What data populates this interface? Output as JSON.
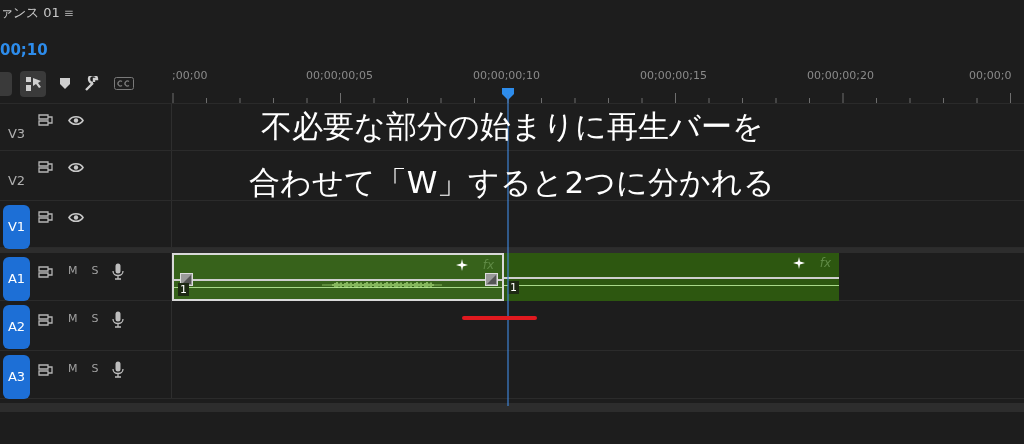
{
  "sequence_tab": {
    "title": "ァンス 01",
    "menu": "≡"
  },
  "timecode": "00;10",
  "ruler_labels": [
    ";00;00",
    "00;00;00;05",
    "00;00;00;10",
    "00;00;00;15",
    "00;00;00;20",
    "00;00;0"
  ],
  "tracks": [
    {
      "label": "V3",
      "kind": "video",
      "targeted": false
    },
    {
      "label": "V2",
      "kind": "video",
      "targeted": false
    },
    {
      "label": "V1",
      "kind": "video",
      "targeted": true
    },
    {
      "label": "A1",
      "kind": "audio",
      "targeted": true,
      "mute": "M",
      "solo": "S",
      "clips": [
        {
          "channel": "1",
          "fx": "fx",
          "selected": true,
          "kind": "waveform"
        },
        {
          "channel": "1",
          "fx": "fx",
          "selected": false,
          "kind": "silent"
        }
      ]
    },
    {
      "label": "A2",
      "kind": "audio",
      "targeted": true,
      "mute": "M",
      "solo": "S"
    },
    {
      "label": "A3",
      "kind": "audio",
      "targeted": true,
      "mute": "M",
      "solo": "S"
    }
  ],
  "caption": [
    "不必要な部分の始まりに再生バーを",
    "合わせて「W」すると2つに分かれる"
  ]
}
